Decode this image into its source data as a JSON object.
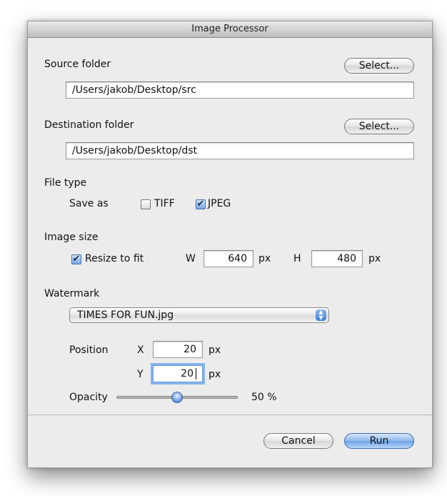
{
  "window": {
    "title": "Image Processor"
  },
  "source": {
    "label": "Source folder",
    "select_label": "Select...",
    "path": "/Users/jakob/Desktop/src"
  },
  "destination": {
    "label": "Destination folder",
    "select_label": "Select...",
    "path": "/Users/jakob/Desktop/dst"
  },
  "file_type": {
    "label": "File type",
    "save_as_label": "Save as",
    "options": [
      {
        "label": "TIFF",
        "checked": false
      },
      {
        "label": "JPEG",
        "checked": true
      }
    ]
  },
  "image_size": {
    "label": "Image size",
    "resize_label": "Resize to fit",
    "resize_checked": true,
    "w_label": "W",
    "w_value": "640",
    "w_unit": "px",
    "h_label": "H",
    "h_value": "480",
    "h_unit": "px"
  },
  "watermark": {
    "label": "Watermark",
    "selected_file": "TIMES FOR FUN.jpg",
    "position_label": "Position",
    "x_label": "X",
    "x_value": "20",
    "x_unit": "px",
    "y_label": "Y",
    "y_value": "20",
    "y_unit": "px",
    "opacity_label": "Opacity",
    "opacity_value": "50 %",
    "opacity_fraction": 0.5
  },
  "buttons": {
    "cancel_label": "Cancel",
    "run_label": "Run"
  },
  "icons": {
    "popup": "up-down-arrows-icon",
    "check": "checkmark-icon"
  },
  "colors": {
    "accent": "#6ea2e6",
    "window_bg": "#ececec"
  }
}
